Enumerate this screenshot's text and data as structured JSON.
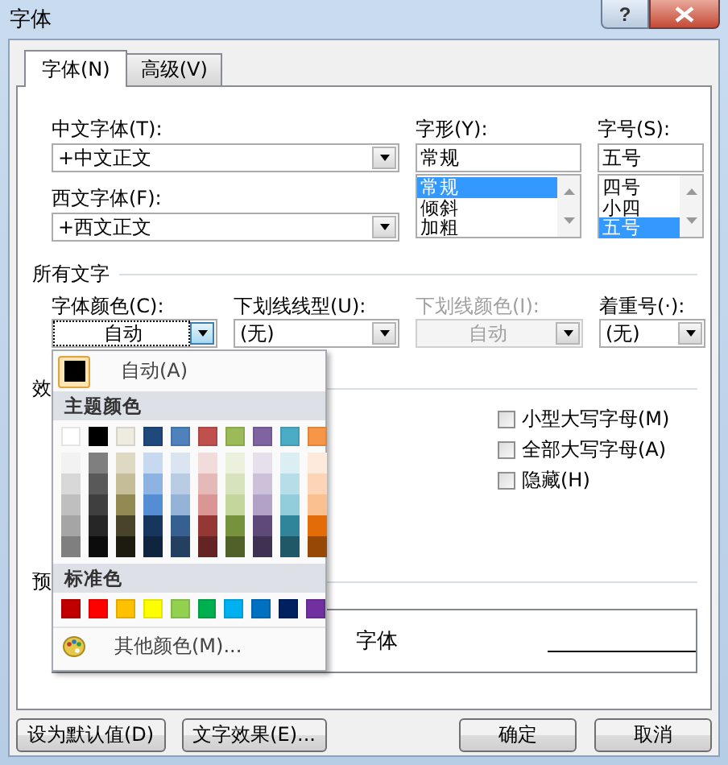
{
  "window": {
    "title": "字体",
    "help": "?"
  },
  "tabs": [
    {
      "label": "字体(N)",
      "selected": true
    },
    {
      "label": "高级(V)",
      "selected": false
    }
  ],
  "font": {
    "chinese_font": {
      "label": "中文字体(T):",
      "value": "+中文正文"
    },
    "western_font": {
      "label": "西文字体(F):",
      "value": "+西文正文"
    },
    "style": {
      "label": "字形(Y):",
      "value": "常规",
      "options": [
        {
          "label": "常规",
          "selected": true
        },
        {
          "label": "倾斜",
          "selected": false
        },
        {
          "label": "加粗",
          "selected": false
        }
      ]
    },
    "size": {
      "label": "字号(S):",
      "value": "五号",
      "options": [
        {
          "label": "四号",
          "selected": false
        },
        {
          "label": "小四",
          "selected": false
        },
        {
          "label": "五号",
          "selected": true
        }
      ]
    }
  },
  "all_text": {
    "heading": "所有文字",
    "fields": [
      {
        "label": "字体颜色(C):",
        "value": "自动",
        "disabled": false,
        "focused": true
      },
      {
        "label": "下划线线型(U):",
        "value": "(无)",
        "disabled": false,
        "focused": false
      },
      {
        "label": "下划线颜色(I):",
        "value": "自动",
        "disabled": true,
        "focused": false
      },
      {
        "label": "着重号(·):",
        "value": "(无)",
        "disabled": false,
        "focused": false
      }
    ]
  },
  "effects": {
    "heading": "效",
    "checkboxes": [
      {
        "label": "小型大写字母(M)",
        "checked": false
      },
      {
        "label": "全部大写字母(A)",
        "checked": false
      },
      {
        "label": "隐藏(H)",
        "checked": false
      }
    ]
  },
  "preview": {
    "heading": "预",
    "sample": "字体"
  },
  "color_menu": {
    "automatic": {
      "label": "自动(A)",
      "color": "#000000",
      "selected": true
    },
    "theme_heading": "主题颜色",
    "theme_colors": [
      {
        "color": "#ffffff",
        "shades": [
          {
            "color": "#f2f2f2"
          },
          {
            "color": "#d8d8d8"
          },
          {
            "color": "#bfbfbf"
          },
          {
            "color": "#a5a5a5"
          },
          {
            "color": "#7f7f7f"
          }
        ]
      },
      {
        "color": "#000000",
        "shades": [
          {
            "color": "#7f7f7f"
          },
          {
            "color": "#595959"
          },
          {
            "color": "#3f3f3f"
          },
          {
            "color": "#262626"
          },
          {
            "color": "#0c0c0c"
          }
        ]
      },
      {
        "color": "#eeece1",
        "shades": [
          {
            "color": "#ddd9c3"
          },
          {
            "color": "#c4bd97"
          },
          {
            "color": "#938953"
          },
          {
            "color": "#494429"
          },
          {
            "color": "#1d1b10"
          }
        ]
      },
      {
        "color": "#1f497d",
        "shades": [
          {
            "color": "#c6d9f0"
          },
          {
            "color": "#8db3e2"
          },
          {
            "color": "#548dd4"
          },
          {
            "color": "#17365d"
          },
          {
            "color": "#0f243e"
          }
        ]
      },
      {
        "color": "#4f81bd",
        "shades": [
          {
            "color": "#dbe5f1"
          },
          {
            "color": "#b8cce4"
          },
          {
            "color": "#95b3d7"
          },
          {
            "color": "#366092"
          },
          {
            "color": "#244061"
          }
        ]
      },
      {
        "color": "#c0504d",
        "shades": [
          {
            "color": "#f2dcdb"
          },
          {
            "color": "#e5b9b7"
          },
          {
            "color": "#d99694"
          },
          {
            "color": "#953734"
          },
          {
            "color": "#632423"
          }
        ]
      },
      {
        "color": "#9bbb59",
        "shades": [
          {
            "color": "#ebf1dd"
          },
          {
            "color": "#d7e3bc"
          },
          {
            "color": "#c3d69b"
          },
          {
            "color": "#76923c"
          },
          {
            "color": "#4f6128"
          }
        ]
      },
      {
        "color": "#8064a2",
        "shades": [
          {
            "color": "#e5e0ec"
          },
          {
            "color": "#ccc1d9"
          },
          {
            "color": "#b2a2c7"
          },
          {
            "color": "#5f497a"
          },
          {
            "color": "#3f3151"
          }
        ]
      },
      {
        "color": "#4bacc6",
        "shades": [
          {
            "color": "#dbeef3"
          },
          {
            "color": "#b7dde8"
          },
          {
            "color": "#92cddc"
          },
          {
            "color": "#31859b"
          },
          {
            "color": "#205867"
          }
        ]
      },
      {
        "color": "#f79646",
        "shades": [
          {
            "color": "#fdeada"
          },
          {
            "color": "#fbd5b5"
          },
          {
            "color": "#fac08f"
          },
          {
            "color": "#e36c09"
          },
          {
            "color": "#974806"
          }
        ]
      }
    ],
    "standard_heading": "标准色",
    "standard_colors": [
      {
        "color": "#c00000"
      },
      {
        "color": "#ff0000"
      },
      {
        "color": "#ffc000"
      },
      {
        "color": "#ffff00"
      },
      {
        "color": "#92d050"
      },
      {
        "color": "#00b050"
      },
      {
        "color": "#00b0f0"
      },
      {
        "color": "#0070c0"
      },
      {
        "color": "#002060"
      },
      {
        "color": "#7030a0"
      }
    ],
    "more": "其他颜色(M)..."
  },
  "buttons": [
    {
      "label": "设为默认值(D)"
    },
    {
      "label": "文字效果(E)..."
    },
    {
      "label": "确定"
    },
    {
      "label": "取消"
    }
  ]
}
